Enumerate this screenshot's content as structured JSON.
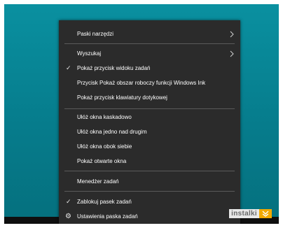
{
  "context_menu": {
    "items": [
      {
        "label": "Paski narzędzi",
        "submenu": true
      },
      {
        "label": "Wyszukaj",
        "submenu": true
      },
      {
        "label": "Pokaż przycisk widoku zadań",
        "checked": true
      },
      {
        "label": "Przycisk Pokaż obszar roboczy funkcji Windows Ink"
      },
      {
        "label": "Pokaż przycisk klawiatury dotykowej"
      },
      {
        "label": "Ułóż okna kaskadowo"
      },
      {
        "label": "Ułóż okna jedno nad drugim"
      },
      {
        "label": "Ułóż okna obok siebie"
      },
      {
        "label": "Pokaż otwarte okna"
      },
      {
        "label": "Menedżer zadań"
      },
      {
        "label": "Zablokuj pasek zadań",
        "checked": true
      },
      {
        "label": "Ustawienia paska zadań",
        "icon": "gear-icon"
      }
    ]
  },
  "icons": {
    "check": "✓",
    "gear": "⚙",
    "submenu": "chevron-right-icon"
  },
  "watermark": {
    "text": "instalki"
  },
  "colors": {
    "desktop": "#0a90a0",
    "menu_bg": "#2b2b2b",
    "menu_text": "#ffffff",
    "separator": "#5a5a5a",
    "taskbar": "#0f0f0f",
    "watermark_accent": "#f2a900"
  }
}
